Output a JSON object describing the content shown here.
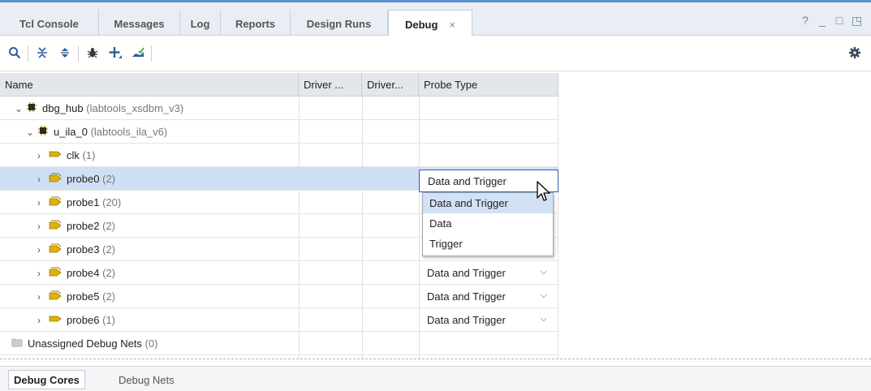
{
  "tabs": [
    {
      "label": "Tcl Console"
    },
    {
      "label": "Messages"
    },
    {
      "label": "Log"
    },
    {
      "label": "Reports"
    },
    {
      "label": "Design Runs"
    },
    {
      "label": "Debug",
      "close": "×"
    }
  ],
  "window_controls": [
    "?",
    "_",
    "□",
    "◳"
  ],
  "toolbar": {
    "icons": [
      "search-icon",
      "collapse-all-icon",
      "expand-all-icon",
      "debug-bug-icon",
      "add-probe-icon",
      "auto-connect-icon"
    ],
    "settings_icon": "gear-icon"
  },
  "table": {
    "headers": [
      "Name",
      "Driver ...",
      "Driver...",
      "Probe Type"
    ],
    "rows": [
      {
        "name": "dbg_hub",
        "suffix": "(labtools_xsdbm_v3)",
        "chev": "⌄",
        "icon": "chip-icon",
        "probe": ""
      },
      {
        "name": "u_ila_0",
        "suffix": "(labtools_ila_v6)",
        "chev": "⌄",
        "icon": "chip-icon",
        "probe": ""
      },
      {
        "name": "clk",
        "suffix": "(1)",
        "chev": "›",
        "icon": "net-icon",
        "probe": ""
      },
      {
        "name": "probe0",
        "suffix": "(2)",
        "chev": "›",
        "icon": "bus-icon",
        "probe": "Data and Trigger"
      },
      {
        "name": "probe1",
        "suffix": "(20)",
        "chev": "›",
        "icon": "bus-icon",
        "probe": ""
      },
      {
        "name": "probe2",
        "suffix": "(2)",
        "chev": "›",
        "icon": "bus-icon",
        "probe": ""
      },
      {
        "name": "probe3",
        "suffix": "(2)",
        "chev": "›",
        "icon": "bus-icon",
        "probe": ""
      },
      {
        "name": "probe4",
        "suffix": "(2)",
        "chev": "›",
        "icon": "bus-icon",
        "probe": "Data and Trigger"
      },
      {
        "name": "probe5",
        "suffix": "(2)",
        "chev": "›",
        "icon": "bus-icon",
        "probe": "Data and Trigger"
      },
      {
        "name": "probe6",
        "suffix": "(1)",
        "chev": "›",
        "icon": "net-icon",
        "probe": "Data and Trigger"
      },
      {
        "name": "Unassigned Debug Nets",
        "suffix": "(0)",
        "chev": "",
        "icon": "folder-icon",
        "probe": ""
      }
    ]
  },
  "probe_dropdown": {
    "selected": "Data and Trigger",
    "options": [
      "Data and Trigger",
      "Data",
      "Trigger"
    ]
  },
  "bottom_tabs": [
    "Debug Cores",
    "Debug Nets"
  ],
  "colors": {
    "accent": "#5a8fc9",
    "selection": "#cfe0f5",
    "icon_yellow": "#d9a400"
  }
}
